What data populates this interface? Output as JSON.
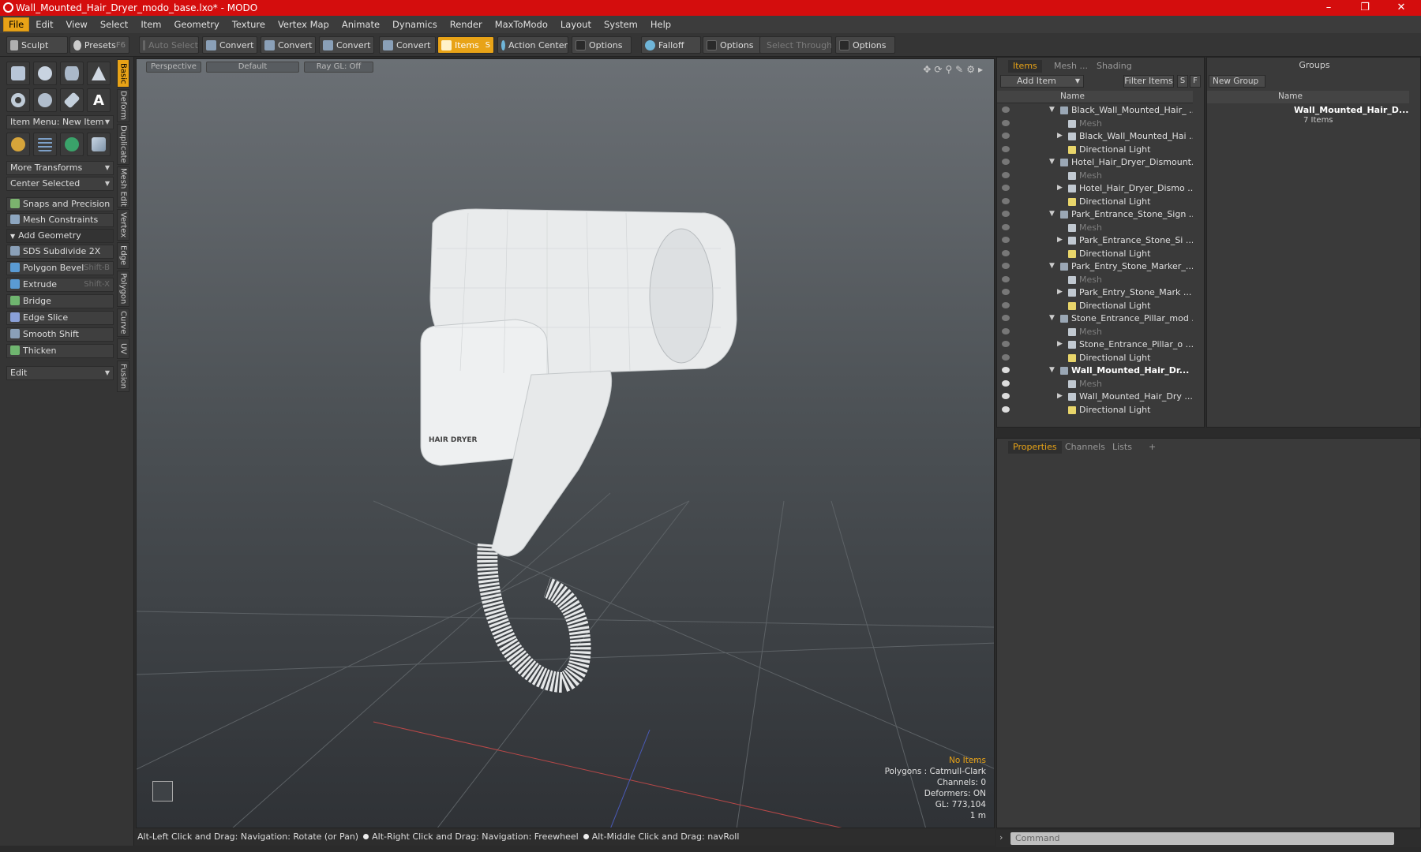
{
  "titlebar": {
    "title": "Wall_Mounted_Hair_Dryer_modo_base.lxo* - MODO"
  },
  "menu": [
    "File",
    "Edit",
    "View",
    "Select",
    "Item",
    "Geometry",
    "Texture",
    "Vertex Map",
    "Animate",
    "Dynamics",
    "Render",
    "MaxToModo",
    "Layout",
    "System",
    "Help"
  ],
  "toolbar": {
    "sculpt": "Sculpt",
    "presets": "Presets",
    "presets_key": "F6",
    "auto_select": "Auto Select",
    "convert1": "Convert",
    "convert2": "Convert",
    "convert3": "Convert",
    "convert4": "Convert",
    "items": "Items",
    "items_key": "S",
    "action_center": "Action Center",
    "options1": "Options",
    "falloff": "Falloff",
    "options2": "Options",
    "select_through": "Select Through",
    "options3": "Options"
  },
  "left": {
    "item_menu": "Item Menu: New Item",
    "more_transforms": "More Transforms",
    "center_selected": "Center Selected",
    "snaps": "Snaps and Precision",
    "mesh_constraints": "Mesh Constraints",
    "add_geometry": "Add Geometry",
    "tools": [
      {
        "label": "SDS Subdivide 2X",
        "key": ""
      },
      {
        "label": "Polygon Bevel",
        "key": "Shift-B"
      },
      {
        "label": "Extrude",
        "key": "Shift-X"
      },
      {
        "label": "Bridge",
        "key": ""
      },
      {
        "label": "Edge Slice",
        "key": ""
      },
      {
        "label": "Smooth Shift",
        "key": ""
      },
      {
        "label": "Thicken",
        "key": ""
      }
    ],
    "edit": "Edit",
    "vtabs": [
      "Basic",
      "Deform",
      "Duplicate",
      "Mesh Edit",
      "Vertex",
      "Edge",
      "Polygon",
      "Curve",
      "UV",
      "Fusion"
    ]
  },
  "viewport": {
    "tab_perspective": "Perspective",
    "tab_default": "Default",
    "tab_raygl": "Ray GL: Off",
    "model_label": "HAIR DRYER",
    "stats": {
      "selection": "No Items",
      "polygons": "Polygons : Catmull-Clark",
      "channels": "Channels: 0",
      "deformers": "Deformers: ON",
      "gl": "GL: 773,104",
      "scale": "1 m"
    }
  },
  "status": {
    "hint1": "Alt-Left Click and Drag: Navigation: Rotate (or Pan)",
    "hint2": "Alt-Right Click and Drag: Navigation: Freewheel",
    "hint3": "Alt-Middle Click and Drag: navRoll"
  },
  "items_panel": {
    "tabs": [
      "Items",
      "Mesh ...",
      "Shading"
    ],
    "add_item": "Add Item",
    "filter_items": "Filter Items",
    "btn_s": "S",
    "btn_f": "F",
    "col_name": "Name",
    "rows": [
      {
        "label": "Black_Wall_Mounted_Hair_ ...",
        "level": 0,
        "type": "scene",
        "dim": false,
        "bold": false,
        "eye": false
      },
      {
        "label": "Mesh",
        "level": 1,
        "type": "mesh",
        "dim": true,
        "bold": false,
        "eye": false
      },
      {
        "label": "Black_Wall_Mounted_Hai ...",
        "level": 1,
        "type": "mesh",
        "dim": false,
        "bold": false,
        "eye": false,
        "expand": true
      },
      {
        "label": "Directional Light",
        "level": 1,
        "type": "light",
        "dim": false,
        "bold": false,
        "eye": false
      },
      {
        "label": "Hotel_Hair_Dryer_Dismount...",
        "level": 0,
        "type": "scene",
        "dim": false,
        "bold": false,
        "eye": false
      },
      {
        "label": "Mesh",
        "level": 1,
        "type": "mesh",
        "dim": true,
        "bold": false,
        "eye": false
      },
      {
        "label": "Hotel_Hair_Dryer_Dismo ...",
        "level": 1,
        "type": "mesh",
        "dim": false,
        "bold": false,
        "eye": false,
        "expand": true
      },
      {
        "label": "Directional Light",
        "level": 1,
        "type": "light",
        "dim": false,
        "bold": false,
        "eye": false
      },
      {
        "label": "Park_Entrance_Stone_Sign ...",
        "level": 0,
        "type": "scene",
        "dim": false,
        "bold": false,
        "eye": false
      },
      {
        "label": "Mesh",
        "level": 1,
        "type": "mesh",
        "dim": true,
        "bold": false,
        "eye": false
      },
      {
        "label": "Park_Entrance_Stone_Si ...",
        "level": 1,
        "type": "mesh",
        "dim": false,
        "bold": false,
        "eye": false,
        "expand": true
      },
      {
        "label": "Directional Light",
        "level": 1,
        "type": "light",
        "dim": false,
        "bold": false,
        "eye": false
      },
      {
        "label": "Park_Entry_Stone_Marker_...",
        "level": 0,
        "type": "scene",
        "dim": false,
        "bold": false,
        "eye": false
      },
      {
        "label": "Mesh",
        "level": 1,
        "type": "mesh",
        "dim": true,
        "bold": false,
        "eye": false
      },
      {
        "label": "Park_Entry_Stone_Mark ...",
        "level": 1,
        "type": "mesh",
        "dim": false,
        "bold": false,
        "eye": false,
        "expand": true
      },
      {
        "label": "Directional Light",
        "level": 1,
        "type": "light",
        "dim": false,
        "bold": false,
        "eye": false
      },
      {
        "label": "Stone_Entrance_Pillar_mod ...",
        "level": 0,
        "type": "scene",
        "dim": false,
        "bold": false,
        "eye": false
      },
      {
        "label": "Mesh",
        "level": 1,
        "type": "mesh",
        "dim": true,
        "bold": false,
        "eye": false
      },
      {
        "label": "Stone_Entrance_Pillar_o ...",
        "level": 1,
        "type": "mesh",
        "dim": false,
        "bold": false,
        "eye": false,
        "expand": true
      },
      {
        "label": "Directional Light",
        "level": 1,
        "type": "light",
        "dim": false,
        "bold": false,
        "eye": false
      },
      {
        "label": "Wall_Mounted_Hair_Dr...",
        "level": 0,
        "type": "scene",
        "dim": false,
        "bold": true,
        "eye": true
      },
      {
        "label": "Mesh",
        "level": 1,
        "type": "mesh",
        "dim": true,
        "bold": false,
        "eye": true
      },
      {
        "label": "Wall_Mounted_Hair_Dry ...",
        "level": 1,
        "type": "mesh",
        "dim": false,
        "bold": false,
        "eye": true,
        "expand": true
      },
      {
        "label": "Directional Light",
        "level": 1,
        "type": "light",
        "dim": false,
        "bold": false,
        "eye": true
      }
    ]
  },
  "groups_panel": {
    "title": "Groups",
    "new_group": "New Group",
    "col_name": "Name",
    "group_name": "Wall_Mounted_Hair_D...",
    "group_count": "7 Items"
  },
  "props_panel": {
    "tabs": [
      "Properties",
      "Channels",
      "Lists"
    ],
    "add": "+"
  },
  "command": {
    "placeholder": "Command"
  },
  "colors": {
    "accent": "#e8a317",
    "titlebar": "#d40d0d"
  }
}
